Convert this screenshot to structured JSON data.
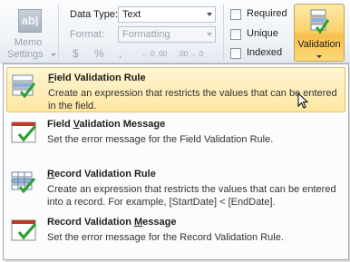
{
  "ribbon": {
    "memo_icon_text": "ab|",
    "memo_label_line1": "Memo",
    "memo_label_line2": "Settings",
    "data_type_label": "Data Type:",
    "data_type_value": "Text",
    "format_label": "Format:",
    "format_value": "Formatting",
    "format_buttons": [
      "$",
      "%",
      ",",
      "←.0 .00",
      ".00 →.0"
    ],
    "checkboxes": [
      {
        "label": "Required",
        "checked": false
      },
      {
        "label": "Unique",
        "checked": false
      },
      {
        "label": "Indexed",
        "checked": false
      }
    ],
    "validation_label": "Validation"
  },
  "menu": {
    "items": [
      {
        "title": "Field Validation Rule",
        "mnemonic": "F",
        "description": "Create an expression that restricts the values that can be entered in the field.",
        "icon": "field-validation-rule-icon",
        "highlighted": true
      },
      {
        "title": "Field Validation Message",
        "mnemonic": "V",
        "description": "Set the error message for the Field Validation Rule.",
        "icon": "field-validation-message-icon",
        "highlighted": false
      },
      {
        "title": "Record Validation Rule",
        "mnemonic": "R",
        "description": "Create an expression that restricts the values that can be entered into a record.  For example, [StartDate] < [EndDate].",
        "icon": "record-validation-rule-icon",
        "highlighted": false
      },
      {
        "title": "Record Validation Message",
        "mnemonic": "M",
        "description": "Set the error message for the Record Validation Rule.",
        "icon": "record-validation-message-icon",
        "highlighted": false
      }
    ]
  },
  "colors": {
    "highlight": "#fde7a1",
    "validation_button": "#f8c04d",
    "check_green": "#2e9e32",
    "disabled_text": "#9aa2ad"
  }
}
